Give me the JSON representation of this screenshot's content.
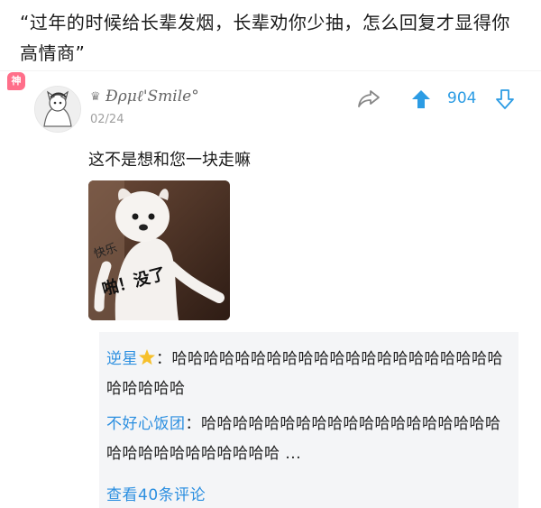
{
  "post": {
    "question": "“过年的时候给长辈发烟，长辈劝你少抽，怎么回复才显得你高情商”"
  },
  "comment": {
    "badge": "神",
    "username": "Ðρμℓ'Smile°",
    "date": "02/24",
    "upvotes": "904",
    "text": "这不是想和您一块走嘛",
    "meme": {
      "caption_top": "快乐",
      "caption_main": "啪！没了"
    }
  },
  "replies": [
    {
      "author": "逆星",
      "separator": "：",
      "text": "哈哈哈哈哈哈哈哈哈哈哈哈哈哈哈哈哈哈哈哈哈哈哈哈哈哈"
    },
    {
      "author": "不好心饭团",
      "separator": "：",
      "text": "哈哈哈哈哈哈哈哈哈哈哈哈哈哈哈哈哈哈哈哈哈哈哈哈哈哈哈哈哈哈 ..."
    }
  ],
  "view_more": "查看40条评论",
  "colors": {
    "accent": "#2c9ce4",
    "badge": "#ff6f8a",
    "reply_bg": "#f4f5f7"
  }
}
